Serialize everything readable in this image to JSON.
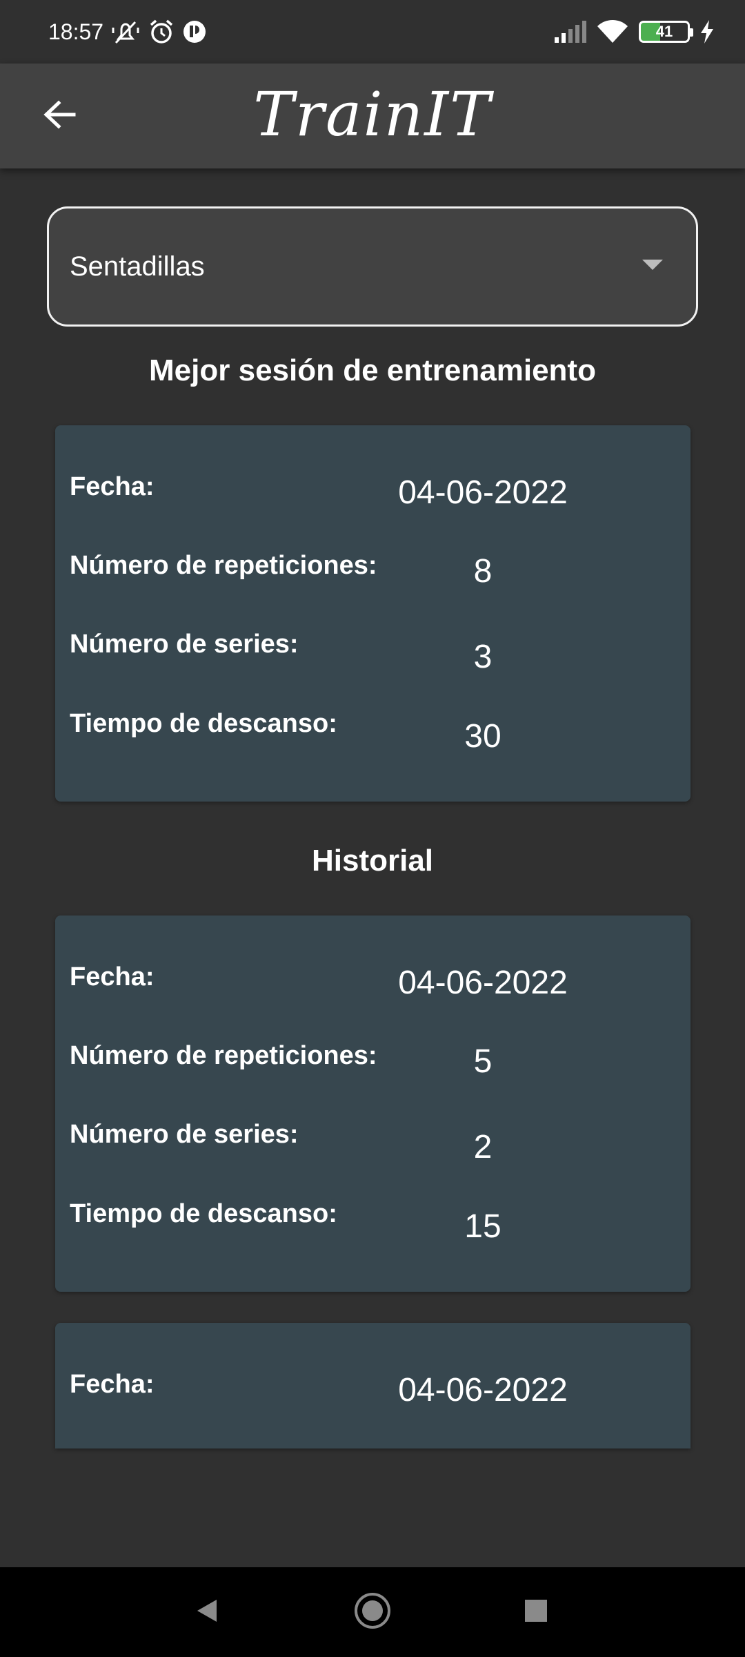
{
  "status_bar": {
    "time": "18:57",
    "battery_level": "41",
    "icons": [
      "silent-icon",
      "alarm-icon",
      "app-notification-icon",
      "signal-icon",
      "wifi-icon",
      "battery-icon",
      "charging-icon"
    ]
  },
  "app_bar": {
    "title": "TrainIT",
    "back_icon": "arrow-back-icon"
  },
  "exercise_select": {
    "selected": "Sentadillas",
    "arrow_icon": "dropdown-arrow-icon"
  },
  "best_session": {
    "heading": "Mejor sesión de entrenamiento",
    "card": {
      "date_label": "Fecha:",
      "date": "04-06-2022",
      "reps_label": "Número de repeticiones:",
      "reps": "8",
      "series_label": "Número de series:",
      "series": "3",
      "rest_label": "Tiempo de descanso:",
      "rest": "30"
    }
  },
  "history": {
    "heading": "Historial",
    "cards": [
      {
        "date_label": "Fecha:",
        "date": "04-06-2022",
        "reps_label": "Número de repeticiones:",
        "reps": "5",
        "series_label": "Número de series:",
        "series": "2",
        "rest_label": "Tiempo de descanso:",
        "rest": "15"
      },
      {
        "date_label": "Fecha:",
        "date": "04-06-2022"
      }
    ]
  },
  "colors": {
    "background": "#303030",
    "app_bar": "#424242",
    "card": "#37474f",
    "text": "#ffffff"
  }
}
